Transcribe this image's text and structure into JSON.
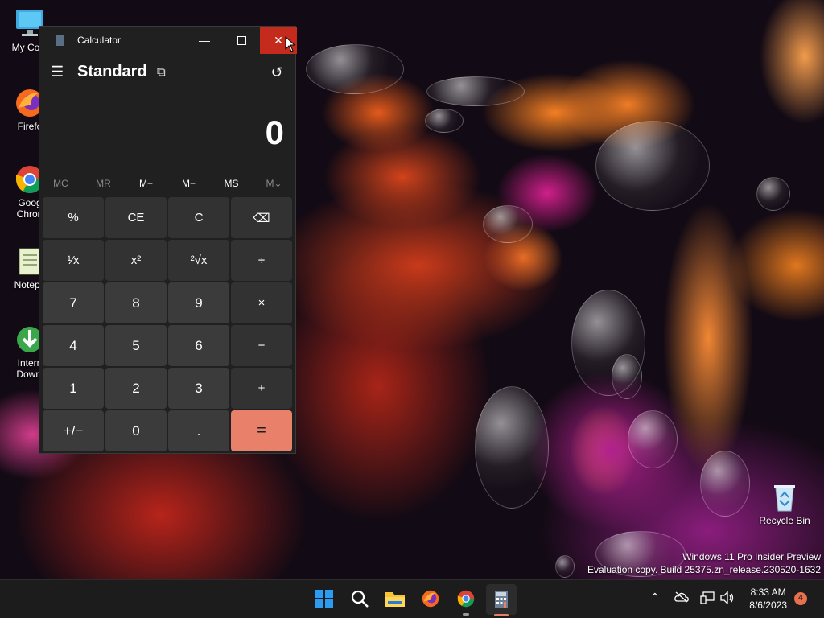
{
  "desktop": {
    "icons": [
      {
        "label": "My Com",
        "icon": "computer-icon"
      },
      {
        "label": "Firefo",
        "icon": "firefox-icon"
      },
      {
        "label": "Goog",
        "label2": "Chron",
        "icon": "chrome-icon"
      },
      {
        "label": "Notepa",
        "icon": "notepad-icon"
      },
      {
        "label": "Intern",
        "label2": "Downl",
        "icon": "internet-download-icon"
      }
    ],
    "recycle_bin_label": "Recycle Bin",
    "watermark_line1": "Windows 11 Pro Insider Preview",
    "watermark_line2": "Evaluation copy. Build 25375.zn_release.230520-1632"
  },
  "calculator": {
    "window_title": "Calculator",
    "mode": "Standard",
    "display_value": "0",
    "memory": [
      "MC",
      "MR",
      "M+",
      "M−",
      "MS",
      "M⌄"
    ],
    "keys": [
      {
        "label": "%",
        "type": "fn"
      },
      {
        "label": "CE",
        "type": "fn"
      },
      {
        "label": "C",
        "type": "fn"
      },
      {
        "label": "⌫",
        "type": "fn"
      },
      {
        "label": "¹⁄x",
        "type": "fn"
      },
      {
        "label": "x²",
        "type": "fn"
      },
      {
        "label": "²√x",
        "type": "fn"
      },
      {
        "label": "÷",
        "type": "fn"
      },
      {
        "label": "7",
        "type": "num"
      },
      {
        "label": "8",
        "type": "num"
      },
      {
        "label": "9",
        "type": "num"
      },
      {
        "label": "×",
        "type": "fn"
      },
      {
        "label": "4",
        "type": "num"
      },
      {
        "label": "5",
        "type": "num"
      },
      {
        "label": "6",
        "type": "num"
      },
      {
        "label": "−",
        "type": "fn"
      },
      {
        "label": "1",
        "type": "num"
      },
      {
        "label": "2",
        "type": "num"
      },
      {
        "label": "3",
        "type": "num"
      },
      {
        "label": "+",
        "type": "fn"
      },
      {
        "label": "+/−",
        "type": "num"
      },
      {
        "label": "0",
        "type": "num"
      },
      {
        "label": ".",
        "type": "num"
      },
      {
        "label": "=",
        "type": "eq"
      }
    ]
  },
  "taskbar": {
    "time": "8:33 AM",
    "date": "8/6/2023",
    "notification_count": "4",
    "pinned": [
      "start-icon",
      "search-icon",
      "file-explorer-icon",
      "firefox-icon",
      "chrome-icon",
      "calculator-icon"
    ]
  },
  "colors": {
    "close_button": "#c42b1c",
    "equals_key": "#e8806a",
    "window_bg": "#202020"
  }
}
